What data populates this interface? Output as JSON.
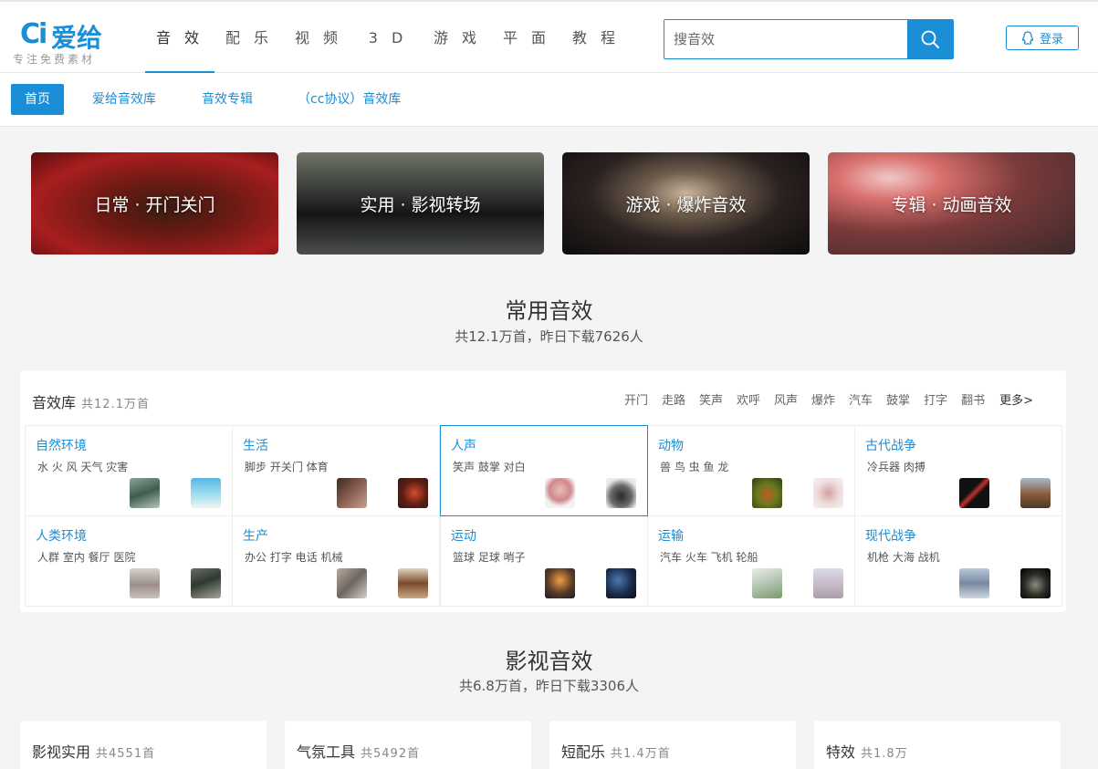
{
  "header": {
    "logo_mark": "Ci",
    "logo_name": "爱给",
    "slogan": "专注免费素材",
    "nav": [
      "音 效",
      "配 乐",
      "视 频",
      "3 D",
      "游 戏",
      "平 面",
      "教 程"
    ],
    "search_placeholder": "搜音效",
    "login_label": "登录"
  },
  "subnav": {
    "items": [
      "首页",
      "爱给音效库",
      "音效专辑",
      "（cc协议）音效库"
    ]
  },
  "banners": [
    "日常 · 开门关门",
    "实用 · 影视转场",
    "游戏 · 爆炸音效",
    "专辑 · 动画音效"
  ],
  "common": {
    "title": "常用音效",
    "subtitle": "共12.1万首，昨日下载7626人"
  },
  "library": {
    "title": "音效库",
    "count": "共12.1万首",
    "tags": [
      "开门",
      "走路",
      "笑声",
      "欢呼",
      "风声",
      "爆炸",
      "汽车",
      "鼓掌",
      "打字",
      "翻书"
    ],
    "more": "更多>",
    "cells": [
      {
        "title": "自然环境",
        "tags": "水 火 风 天气 灾害"
      },
      {
        "title": "生活",
        "tags": "脚步 开关门 体育"
      },
      {
        "title": "人声",
        "tags": "笑声 鼓掌 对白"
      },
      {
        "title": "动物",
        "tags": "兽 鸟 虫 鱼 龙"
      },
      {
        "title": "古代战争",
        "tags": "冷兵器 肉搏"
      },
      {
        "title": "人类环境",
        "tags": "人群 室内 餐厅 医院"
      },
      {
        "title": "生产",
        "tags": "办公 打字 电话 机械"
      },
      {
        "title": "运动",
        "tags": "篮球 足球 哨子"
      },
      {
        "title": "运输",
        "tags": "汽车 火车 飞机 轮船"
      },
      {
        "title": "现代战争",
        "tags": "机枪 大海 战机"
      }
    ]
  },
  "film": {
    "title": "影视音效",
    "subtitle": "共6.8万首，昨日下载3306人",
    "cards": [
      {
        "title": "影视实用",
        "count": "共4551首"
      },
      {
        "title": "气氛工具",
        "count": "共5492首"
      },
      {
        "title": "短配乐",
        "count": "共1.4万首"
      },
      {
        "title": "特效",
        "count": "共1.8万"
      }
    ]
  },
  "colors": {
    "accent": "#1a8ed6",
    "background": "#f4f4f4"
  }
}
